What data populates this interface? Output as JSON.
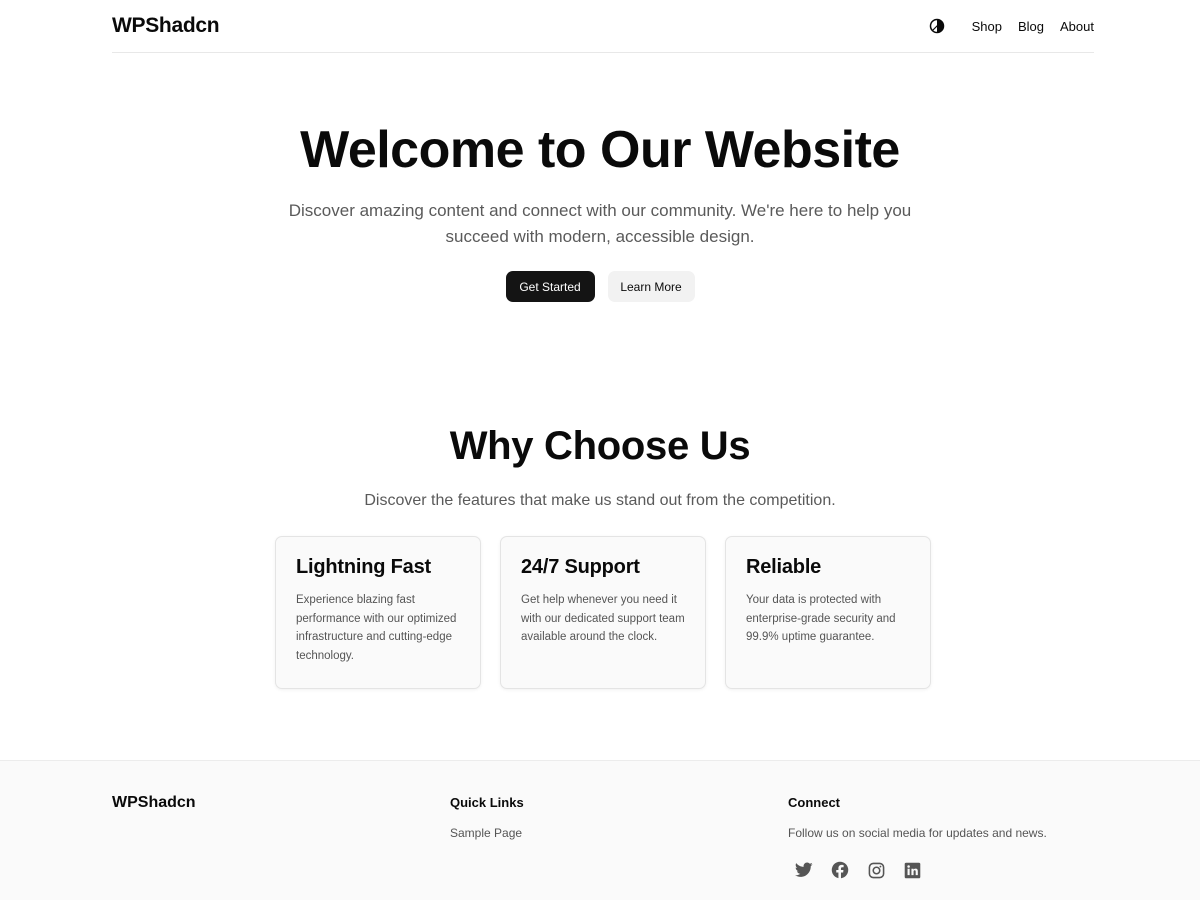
{
  "header": {
    "brand": "WPShadcn",
    "theme_toggle_icon": "theme-toggle-icon",
    "nav": [
      {
        "label": "Shop"
      },
      {
        "label": "Blog"
      },
      {
        "label": "About"
      }
    ]
  },
  "hero": {
    "title": "Welcome to Our Website",
    "subtitle": "Discover amazing content and connect with our community. We're here to help you succeed with modern, accessible design.",
    "primary_button": "Get Started",
    "secondary_button": "Learn More"
  },
  "features": {
    "title": "Why Choose Us",
    "subtitle": "Discover the features that make us stand out from the competition.",
    "cards": [
      {
        "title": "Lightning Fast",
        "text": "Experience blazing fast performance with our optimized infrastructure and cutting-edge technology."
      },
      {
        "title": "24/7 Support",
        "text": "Get help whenever you need it with our dedicated support team available around the clock."
      },
      {
        "title": "Reliable",
        "text": "Your data is protected with enterprise-grade security and 99.9% uptime guarantee."
      }
    ]
  },
  "footer": {
    "brand": "WPShadcn",
    "quick_links_heading": "Quick Links",
    "links": [
      {
        "label": "Sample Page"
      }
    ],
    "connect_heading": "Connect",
    "connect_text": "Follow us on social media for updates and news.",
    "social_icons": [
      "twitter-icon",
      "facebook-icon",
      "instagram-icon",
      "linkedin-icon"
    ]
  },
  "colors": {
    "text": "#0a0a0a",
    "muted": "#5a5a5a",
    "primary_button_bg": "#141414",
    "secondary_button_bg": "#f2f2f2",
    "footer_bg": "#fafafa"
  }
}
